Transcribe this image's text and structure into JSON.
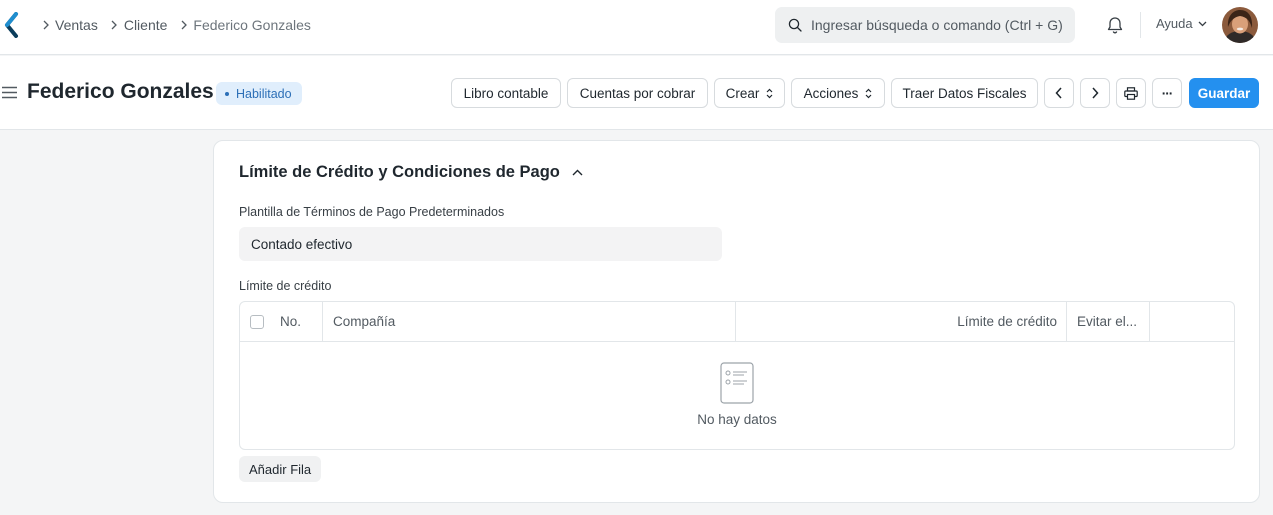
{
  "navbar": {
    "breadcrumbs": [
      "Ventas",
      "Cliente",
      "Federico Gonzales"
    ],
    "search_placeholder": "Ingresar búsqueda o comando (Ctrl + G)",
    "help_label": "Ayuda"
  },
  "header": {
    "title": "Federico Gonzales",
    "status": "Habilitado",
    "buttons": {
      "ledger": "Libro contable",
      "receivable": "Cuentas por cobrar",
      "create": "Crear",
      "actions": "Acciones",
      "fiscal": "Traer Datos Fiscales",
      "more": "···",
      "save": "Guardar"
    }
  },
  "section": {
    "title": "Límite de Crédito y Condiciones de Pago",
    "payment_terms_label": "Plantilla de Términos de Pago Predeterminados",
    "payment_terms_value": "Contado efectivo",
    "credit_limit_label": "Límite de crédito",
    "table": {
      "columns": [
        "No.",
        "Compañía",
        "Límite de crédito",
        "Evitar el..."
      ],
      "rows": [],
      "empty_text": "No hay datos"
    },
    "add_row_label": "Añadir Fila"
  },
  "colors": {
    "primary": "#2490ef",
    "badge_bg": "#e0eefc",
    "badge_text": "#2c6fb7"
  }
}
